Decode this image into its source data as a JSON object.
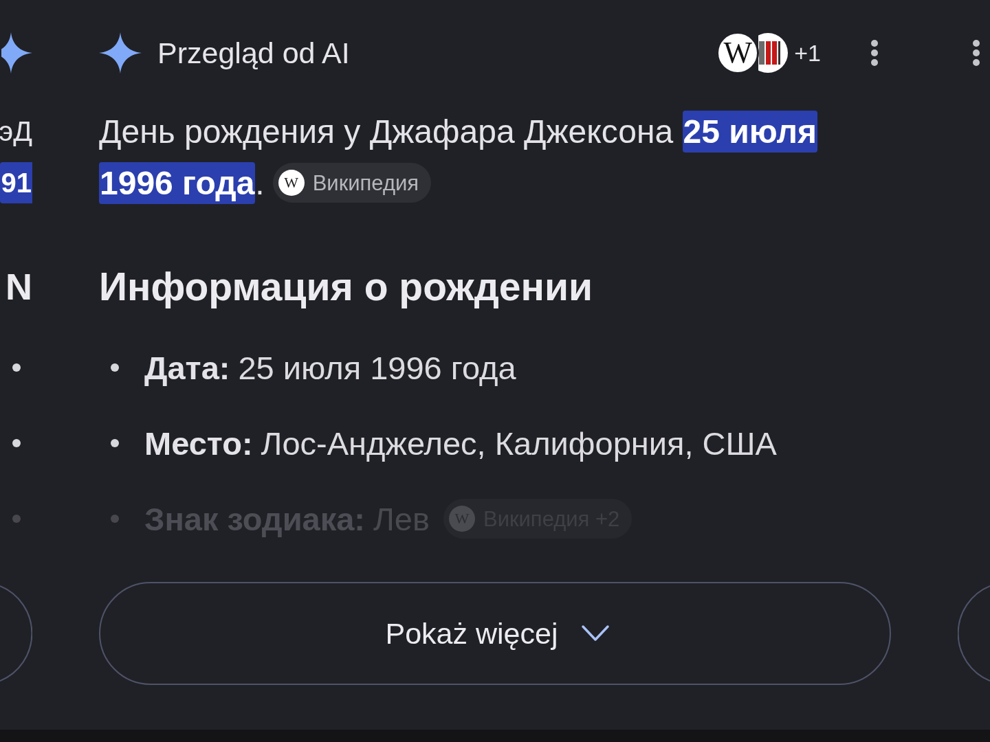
{
  "left_card_edge": {
    "paragraph_lines": [
      "эД",
      "91"
    ],
    "heading": "N",
    "bullets": [
      {
        "faded": false
      },
      {
        "faded": false
      },
      {
        "faded": true
      }
    ]
  },
  "overview": {
    "title": "Przegląd od AI",
    "sources": [
      {
        "kind": "wikipedia",
        "letter": "W"
      },
      {
        "kind": "stripes"
      }
    ],
    "more_sources": "+1",
    "summary": "День рождения у Джафара Джексона **25 июля 1996 года**.",
    "summary_chip": {
      "letter": "W",
      "label": "Википедия"
    },
    "heading": "Информация о рождении",
    "facts": [
      {
        "label": "Дата:",
        "value": "25 июля 1996 года",
        "faded": false
      },
      {
        "label": "Место:",
        "value": "Лос-Анджелес, Калифорния, США",
        "faded": false
      },
      {
        "label": "Знак зодиака:",
        "value": "Лев",
        "faded": true,
        "chip": {
          "letter": "W",
          "label": "Википедия +2"
        }
      }
    ],
    "show_more_button": "Pokaż więcej"
  }
}
